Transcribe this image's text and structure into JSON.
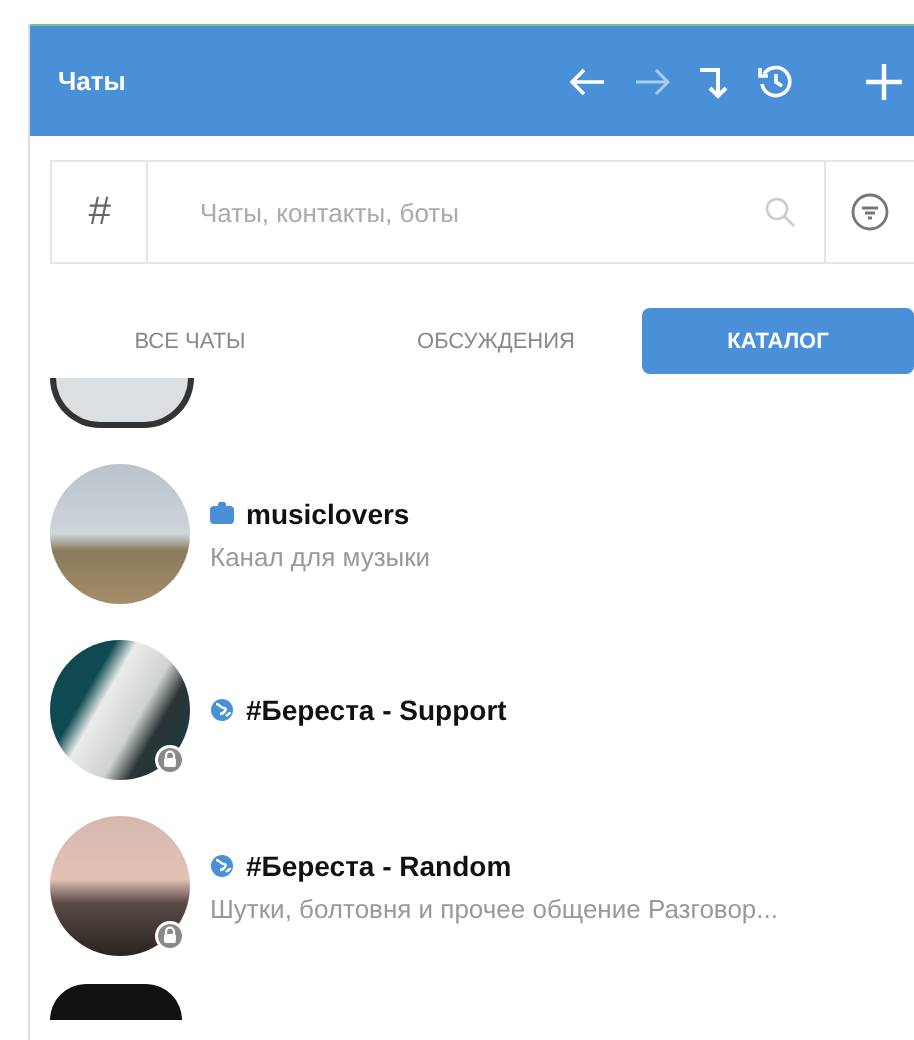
{
  "header": {
    "title": "Чаты"
  },
  "search": {
    "prefix": "#",
    "placeholder": "Чаты, контакты, боты"
  },
  "tabs": [
    {
      "label": "ВСЕ ЧАТЫ",
      "selected": false
    },
    {
      "label": "ОБСУЖДЕНИЯ",
      "selected": false
    },
    {
      "label": "КАТАЛОГ",
      "selected": true
    }
  ],
  "chats": [
    {
      "kind": "channel",
      "name": "musiclovers",
      "subtitle": "Канал для музыки",
      "locked": false
    },
    {
      "kind": "public",
      "name": "#Береста - Support",
      "locked": true
    },
    {
      "kind": "public",
      "name": "#Береста - Random",
      "subtitle": "Шутки, болтовня и прочее общение Разговор...",
      "locked": true
    }
  ]
}
